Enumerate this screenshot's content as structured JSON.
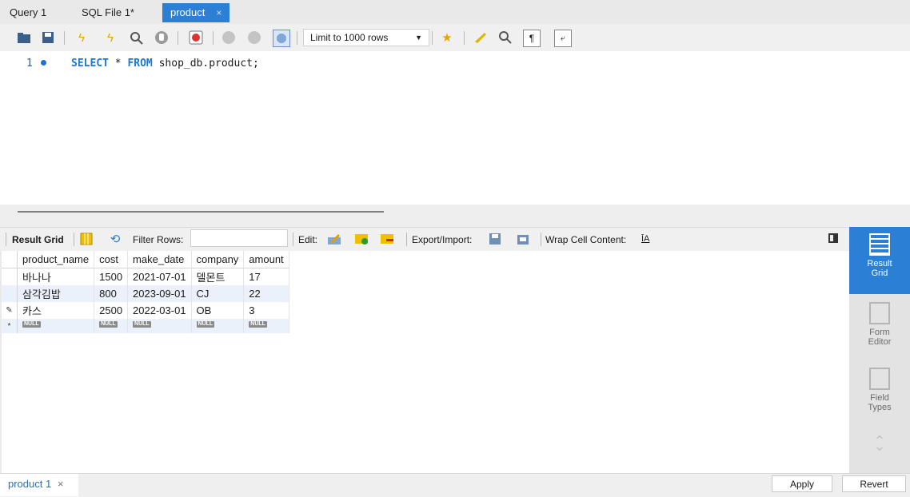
{
  "tabs": [
    {
      "label": "Query 1"
    },
    {
      "label": "SQL File 1*"
    },
    {
      "label": "product",
      "close": "×"
    }
  ],
  "toolbar": {
    "limit_select": "Limit to 1000 rows",
    "icons": [
      "open-folder-icon",
      "save-icon",
      "execute-icon",
      "execute-current-icon",
      "explain-icon",
      "stop-icon",
      "toggle-error-icon",
      "commit-icon",
      "rollback-icon",
      "autocommit-icon",
      "add-snippet-icon",
      "beautify-icon",
      "find-icon",
      "invisible-chars-icon",
      "wrap-icon"
    ]
  },
  "editor": {
    "line_number": "1",
    "code": {
      "kw1": "SELECT",
      "star": " * ",
      "kw2": "FROM",
      "rest": " shop_db.product;"
    }
  },
  "result_toolbar": {
    "result_grid": "Result Grid",
    "filter_rows": "Filter Rows:",
    "edit": "Edit:",
    "export_import": "Export/Import:",
    "wrap": "Wrap Cell Content:",
    "wrap_icon_text": "ĪA"
  },
  "grid": {
    "columns": [
      "product_name",
      "cost",
      "make_date",
      "company",
      "amount"
    ],
    "rows": [
      [
        "바나나",
        "1500",
        "2021-07-01",
        "델몬트",
        "17"
      ],
      [
        "삼각김밥",
        "800",
        "2023-09-01",
        "CJ",
        "22"
      ],
      [
        "카스",
        "2500",
        "2022-03-01",
        "OB",
        "3"
      ]
    ],
    "null_label": "NULL",
    "new_row_marker": "*",
    "edit_marker": "✎"
  },
  "sidebar": {
    "items": [
      {
        "label1": "Result",
        "label2": "Grid"
      },
      {
        "label1": "Form",
        "label2": "Editor"
      },
      {
        "label1": "Field",
        "label2": "Types"
      }
    ]
  },
  "bottom": {
    "tab": "product 1",
    "close": "×",
    "apply": "Apply",
    "revert": "Revert"
  }
}
